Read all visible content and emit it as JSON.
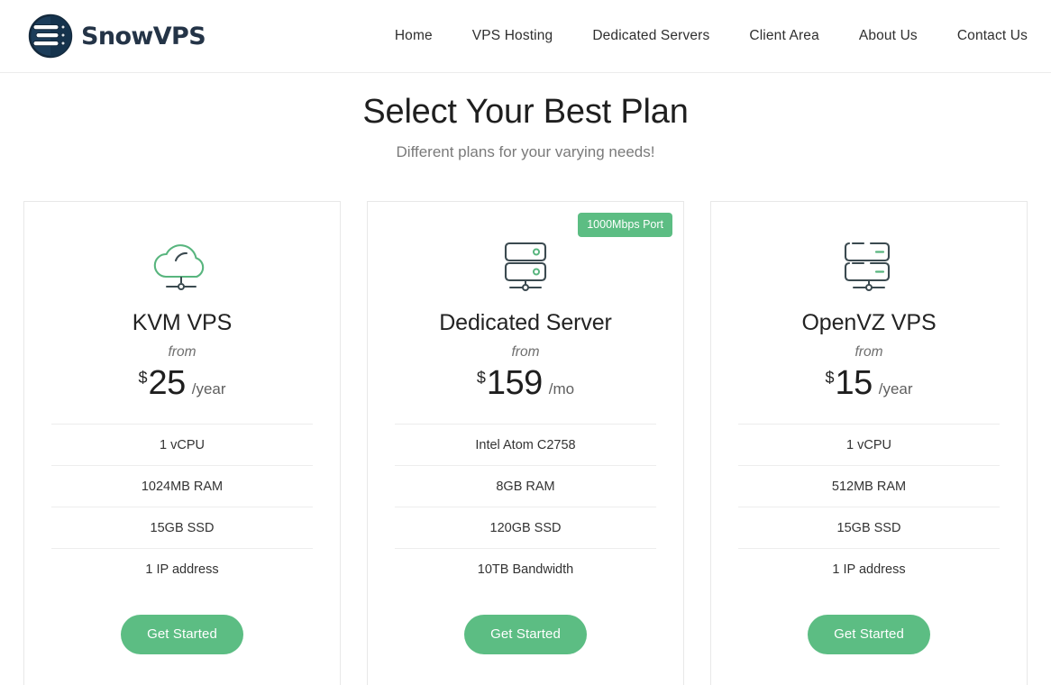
{
  "header": {
    "brand": {
      "name": "SnowVPS",
      "logo_icon": "snowvps-server-circle-logo",
      "logo_circle_color": "#1c3d5a",
      "logo_text_color": "#243447"
    },
    "nav": [
      {
        "label": "Home",
        "name": "home"
      },
      {
        "label": "VPS Hosting",
        "name": "vps-hosting"
      },
      {
        "label": "Dedicated Servers",
        "name": "dedicated-servers"
      },
      {
        "label": "Client Area",
        "name": "client-area"
      },
      {
        "label": "About Us",
        "name": "about-us"
      },
      {
        "label": "Contact Us",
        "name": "contact-us"
      }
    ]
  },
  "page": {
    "title": "Select Your Best Plan",
    "subtitle": "Different plans for your varying needs!"
  },
  "theme": {
    "accent_green": "#5cbd83",
    "card_border": "#e8e8e8",
    "text_dark": "#1e1e1e",
    "text_muted": "#7a7a7a"
  },
  "plans": [
    {
      "id": "kvm-vps",
      "name": "KVM VPS",
      "icon": "cloud-server-icon",
      "from_label": "from",
      "currency": "$",
      "amount": "25",
      "period": "/year",
      "badge": null,
      "features": [
        "1 vCPU",
        "1024MB RAM",
        "15GB SSD",
        "1 IP address"
      ],
      "cta_label": "Get Started"
    },
    {
      "id": "dedicated-server",
      "name": "Dedicated Server",
      "icon": "rack-server-dots-icon",
      "from_label": "from",
      "currency": "$",
      "amount": "159",
      "period": "/mo",
      "badge": "1000Mbps Port",
      "features": [
        "Intel Atom C2758",
        "8GB RAM",
        "120GB SSD",
        "10TB Bandwidth"
      ],
      "cta_label": "Get Started"
    },
    {
      "id": "openvz-vps",
      "name": "OpenVZ VPS",
      "icon": "rack-server-dashes-icon",
      "from_label": "from",
      "currency": "$",
      "amount": "15",
      "period": "/year",
      "badge": null,
      "features": [
        "1 vCPU",
        "512MB RAM",
        "15GB SSD",
        "1 IP address"
      ],
      "cta_label": "Get Started"
    }
  ]
}
